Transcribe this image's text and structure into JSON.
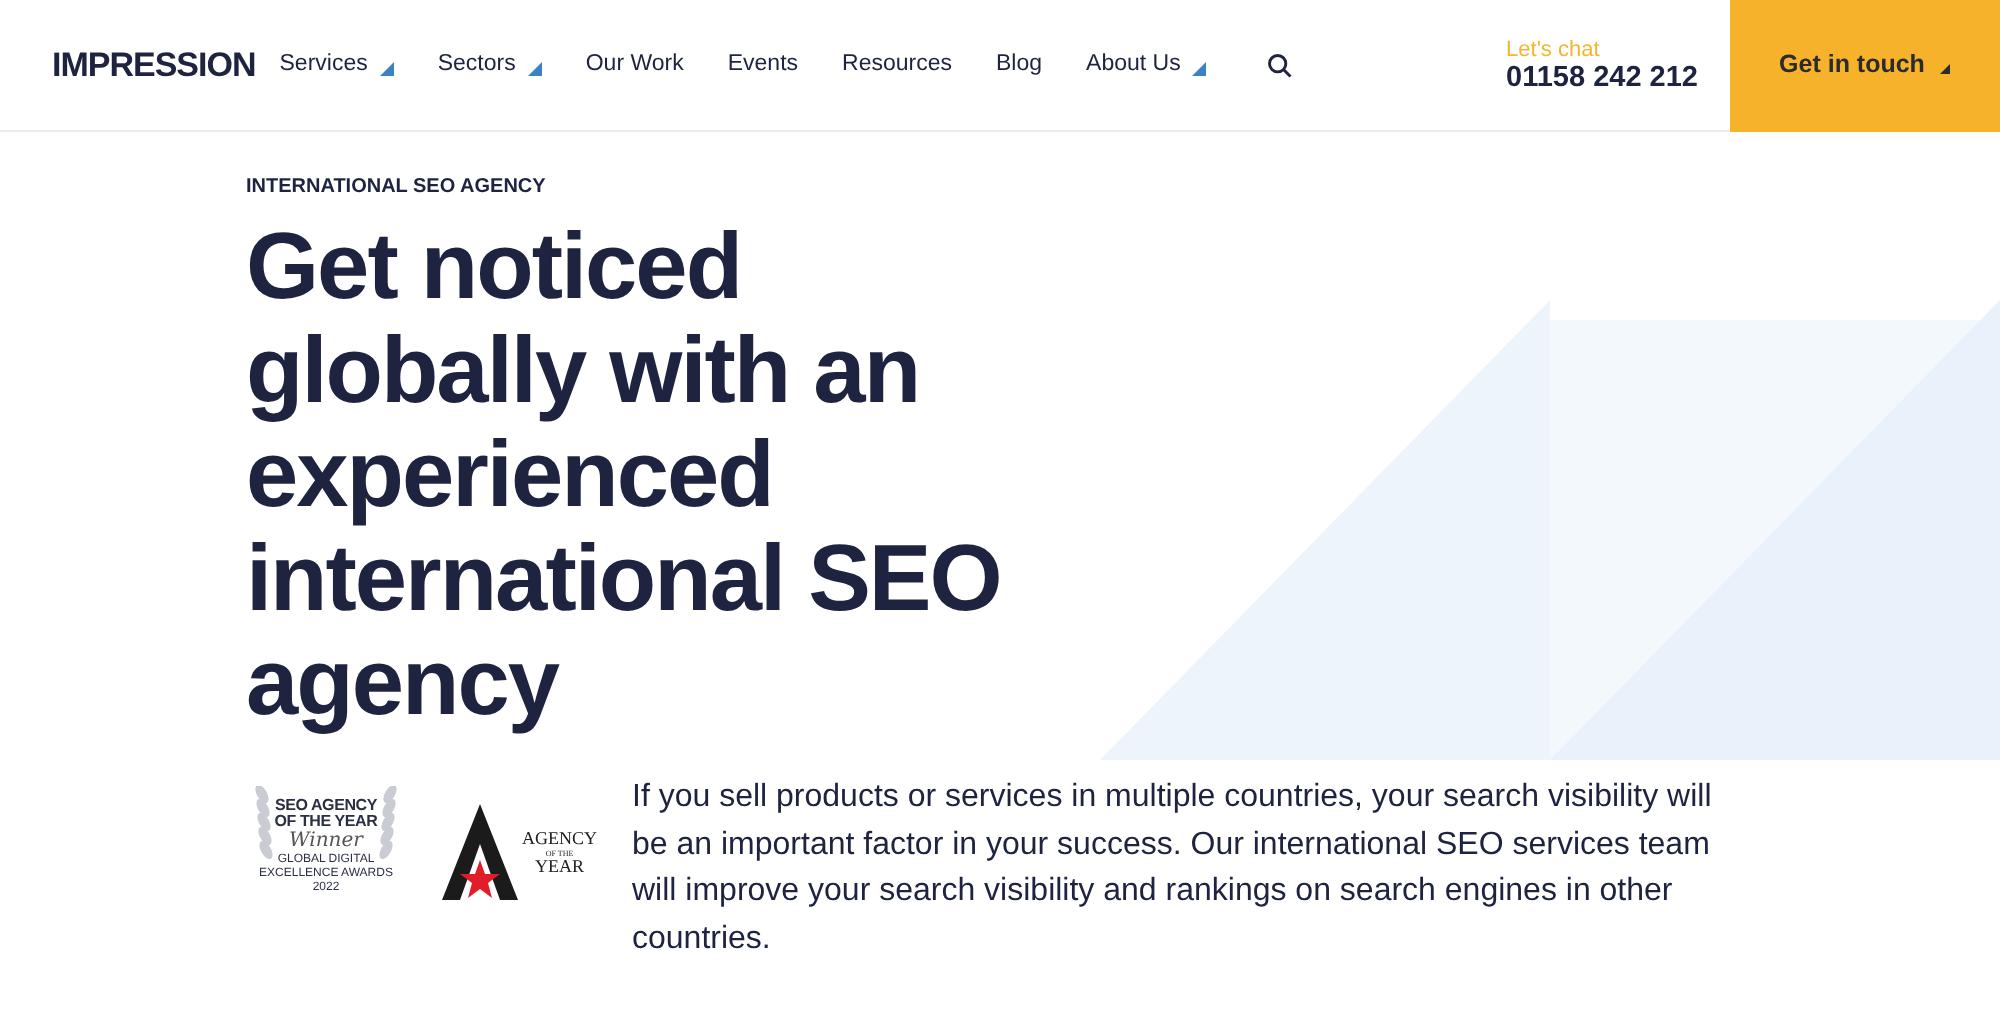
{
  "header": {
    "logo": "IMPRESSION",
    "nav": [
      {
        "label": "Services",
        "has_dropdown": true
      },
      {
        "label": "Sectors",
        "has_dropdown": true
      },
      {
        "label": "Our Work",
        "has_dropdown": false
      },
      {
        "label": "Events",
        "has_dropdown": false
      },
      {
        "label": "Resources",
        "has_dropdown": false
      },
      {
        "label": "Blog",
        "has_dropdown": false
      },
      {
        "label": "About Us",
        "has_dropdown": true
      }
    ],
    "contact_label": "Let's chat",
    "phone": "01158 242 212",
    "cta": "Get in touch"
  },
  "hero": {
    "eyebrow": "INTERNATIONAL SEO AGENCY",
    "heading": "Get noticed globally with an experienced international SEO agency",
    "badges": [
      {
        "kind": "laurel",
        "lines": [
          "SEO AGENCY",
          "OF THE YEAR"
        ],
        "script": "Winner",
        "footer": [
          "GLOBAL DIGITAL",
          "EXCELLENCE AWARDS",
          "2022"
        ]
      },
      {
        "kind": "star",
        "lines": [
          "AGENCY",
          "OF THE",
          "YEAR"
        ]
      }
    ],
    "body": "If you sell products or services in multiple countries, your search visibility will be an important factor in your success. Our international SEO services team will improve your search visibility and rankings on search engines in other countries."
  }
}
